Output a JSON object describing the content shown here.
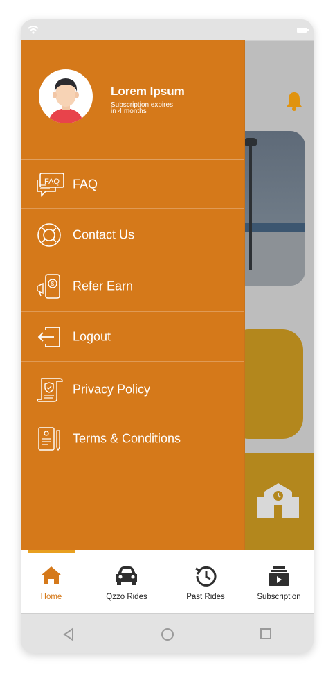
{
  "colors": {
    "drawer": "#d5791a",
    "accent": "#e8a020",
    "gold": "#b3871d",
    "active_tab": "#d5791a"
  },
  "status_bar": {
    "wifi_icon": "wifi-icon",
    "battery_icon": "battery-icon"
  },
  "profile": {
    "name": "Lorem Ipsum",
    "subscription_line1": "Subscription expires",
    "subscription_line2": "in 4 months"
  },
  "menu": {
    "items": [
      {
        "label": "FAQ",
        "icon": "faq-icon"
      },
      {
        "label": "Contact Us",
        "icon": "lifebuoy-icon"
      },
      {
        "label": "Refer Earn",
        "icon": "refer-earn-icon"
      },
      {
        "label": "Logout",
        "icon": "logout-icon"
      },
      {
        "label": "Privacy Policy",
        "icon": "privacy-policy-icon"
      },
      {
        "label": "Terms & Conditions",
        "icon": "terms-icon"
      }
    ]
  },
  "tabs": [
    {
      "label": "Home",
      "icon": "home-icon",
      "active": true
    },
    {
      "label": "Qzzo Rides",
      "icon": "car-icon",
      "active": false
    },
    {
      "label": "Past Rides",
      "icon": "history-icon",
      "active": false
    },
    {
      "label": "Subscription",
      "icon": "subscription-icon",
      "active": false
    }
  ],
  "system_nav": {
    "back": "back-icon",
    "home": "home-circle-icon",
    "recents": "recents-icon"
  }
}
